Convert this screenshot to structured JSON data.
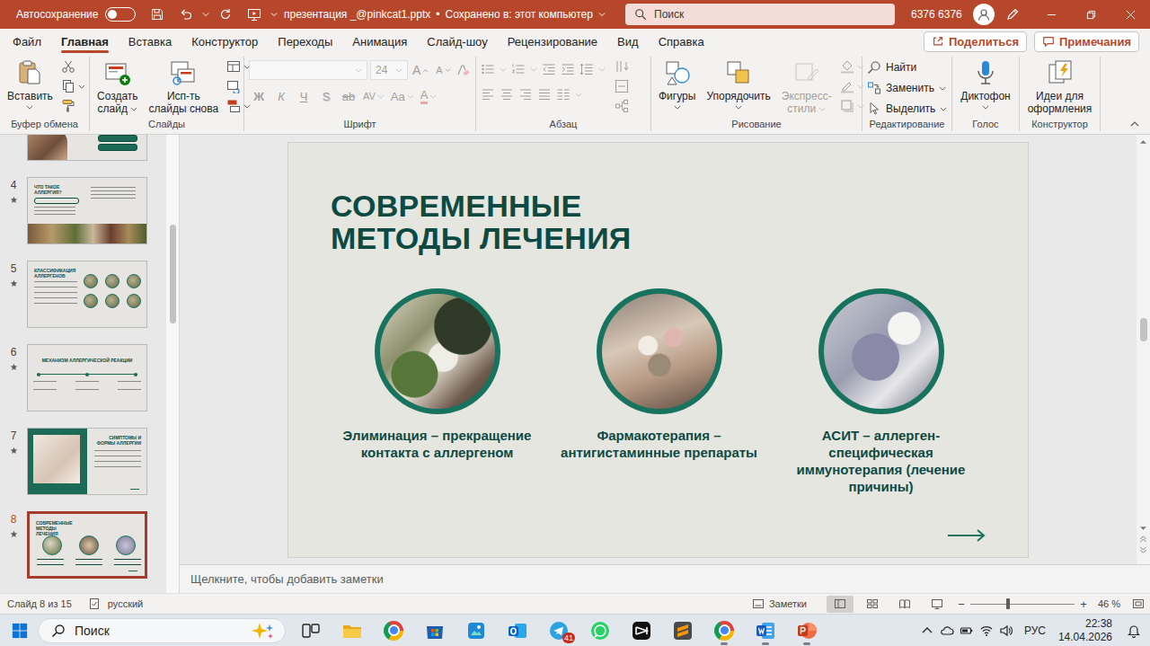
{
  "title_bar": {
    "autosave_label": "Автосохранение",
    "autosave_on": false,
    "file_name": "презентация _@pinkcat1.pptx",
    "separator": "•",
    "save_status": "Сохранено в: этот компьютер",
    "search_placeholder": "Поиск",
    "user_name": "6376 6376"
  },
  "menu_tabs": [
    {
      "label": "Файл",
      "selected": false
    },
    {
      "label": "Главная",
      "selected": true
    },
    {
      "label": "Вставка",
      "selected": false
    },
    {
      "label": "Конструктор",
      "selected": false
    },
    {
      "label": "Переходы",
      "selected": false
    },
    {
      "label": "Анимация",
      "selected": false
    },
    {
      "label": "Слайд-шоу",
      "selected": false
    },
    {
      "label": "Рецензирование",
      "selected": false
    },
    {
      "label": "Вид",
      "selected": false
    },
    {
      "label": "Справка",
      "selected": false
    }
  ],
  "share_button": "Поделиться",
  "comments_button": "Примечания",
  "ribbon": {
    "clipboard": {
      "label": "Буфер обмена",
      "paste": "Вставить"
    },
    "slides": {
      "label": "Слайды",
      "new_slide": [
        "Создать",
        "слайд"
      ],
      "reuse": [
        "Исп-ть",
        "слайды снова"
      ]
    },
    "font": {
      "label": "Шрифт",
      "disabled": true,
      "font_name": "",
      "font_size": "24",
      "size_buttons": [
        "A",
        "A"
      ],
      "format_buttons": [
        "Ж",
        "К",
        "Ч",
        "S",
        "ab",
        "AV",
        "Aa",
        "A"
      ]
    },
    "paragraph": {
      "label": "Абзац",
      "disabled": true
    },
    "drawing": {
      "label": "Рисование",
      "shapes": "Фигуры",
      "arrange": "Упорядочить",
      "quick_styles": [
        "Экспресс-",
        "стили"
      ],
      "quick_styles_disabled": true
    },
    "editing": {
      "label": "Редактирование",
      "find": "Найти",
      "replace": "Заменить",
      "select": "Выделить"
    },
    "voice": {
      "label": "Голос",
      "dictate": "Диктофон"
    },
    "designer": {
      "label": "Конструктор",
      "ideas": [
        "Идеи для",
        "оформления"
      ]
    }
  },
  "thumbnails": [
    {
      "number": "",
      "title": "",
      "kind": "buttons",
      "transition": false,
      "selected": false
    },
    {
      "number": "4",
      "title": "ЧТО ТАКОЕ АЛЛЕРГИЯ?",
      "kind": "text-photos",
      "transition": true,
      "selected": false
    },
    {
      "number": "5",
      "title": "КЛАССИФИКАЦИЯ АЛЛЕРГЕНОВ",
      "kind": "circles",
      "transition": true,
      "selected": false
    },
    {
      "number": "6",
      "title": "МЕХАНИЗМ АЛЛЕРГИЧЕСКОЙ РЕАКЦИИ",
      "kind": "timeline",
      "transition": true,
      "selected": false
    },
    {
      "number": "7",
      "title": "СИМПТОМЫ И ФОРМЫ АЛЛЕРГИИ",
      "kind": "photo-left",
      "transition": true,
      "selected": false
    },
    {
      "number": "8",
      "title": "СОВРЕМЕННЫЕ МЕТОДЫ ЛЕЧЕНИЯ",
      "kind": "circles-row",
      "transition": true,
      "selected": true
    }
  ],
  "slide": {
    "title_lines": [
      "СОВРЕМЕННЫЕ",
      "МЕТОДЫ ЛЕЧЕНИЯ"
    ],
    "methods": [
      {
        "caption_lines": [
          "Элиминация – прекращение",
          "контакта с аллергеном"
        ]
      },
      {
        "caption_lines": [
          "Фармакотерапия –",
          "антигистаминные препараты"
        ]
      },
      {
        "caption_lines": [
          "АСИТ – аллерген-",
          "специфическая",
          "иммунотерапия (лечение",
          "причины)"
        ]
      }
    ]
  },
  "notes_placeholder": "Щелкните, чтобы добавить заметки",
  "status_bar": {
    "slide_info": "Слайд 8 из 15",
    "language": "русский",
    "notes": "Заметки",
    "views": [
      {
        "kind": "normal",
        "selected": true
      },
      {
        "kind": "sorter",
        "selected": false
      },
      {
        "kind": "reading",
        "selected": false
      },
      {
        "kind": "slideshow",
        "selected": false
      }
    ],
    "zoom_out": "−",
    "zoom_in": "+",
    "zoom_level": 0.36,
    "zoom": "46 %"
  },
  "taskbar": {
    "search_placeholder": "Поиск",
    "apps": [
      {
        "kind": "explorer",
        "running": false,
        "badge": ""
      },
      {
        "kind": "chrome",
        "running": false,
        "badge": ""
      },
      {
        "kind": "store",
        "running": false,
        "badge": ""
      },
      {
        "kind": "photos",
        "running": false,
        "badge": ""
      },
      {
        "kind": "outlook",
        "running": false,
        "badge": ""
      },
      {
        "kind": "telegram",
        "running": false,
        "badge": "41"
      },
      {
        "kind": "whatsapp",
        "running": false,
        "badge": ""
      },
      {
        "kind": "capcut",
        "running": false,
        "badge": ""
      },
      {
        "kind": "sublime",
        "running": false,
        "badge": ""
      },
      {
        "kind": "chrome",
        "running": true,
        "badge": ""
      },
      {
        "kind": "word",
        "running": true,
        "badge": ""
      },
      {
        "kind": "powerpoint",
        "running": true,
        "badge": ""
      }
    ],
    "language": "РУС",
    "time": "22:38",
    "date": "14.04.2026"
  }
}
